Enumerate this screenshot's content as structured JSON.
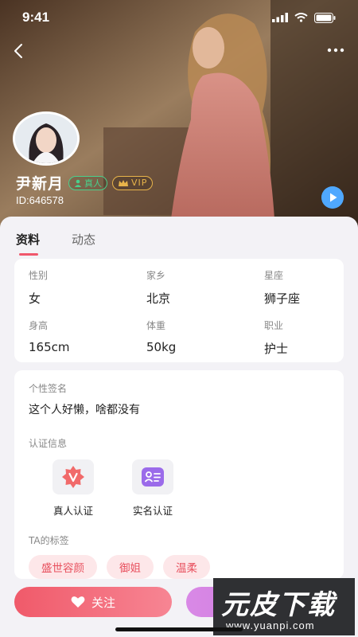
{
  "status_bar": {
    "time": "9:41"
  },
  "profile": {
    "name": "尹新月",
    "real_badge": "真人",
    "vip_badge": "VIP",
    "id_text": "ID:646578"
  },
  "tabs": [
    {
      "label": "资料"
    },
    {
      "label": "动态"
    }
  ],
  "info": [
    {
      "label": "性别",
      "value": "女"
    },
    {
      "label": "家乡",
      "value": "北京"
    },
    {
      "label": "星座",
      "value": "狮子座"
    },
    {
      "label": "身高",
      "value": "165cm"
    },
    {
      "label": "体重",
      "value": "50kg"
    },
    {
      "label": "职业",
      "value": "护士"
    }
  ],
  "signature": {
    "title": "个性签名",
    "text": "这个人好懒，啥都没有"
  },
  "verification": {
    "title": "认证信息",
    "items": [
      {
        "label": "真人认证"
      },
      {
        "label": "实名认证"
      }
    ]
  },
  "tags": {
    "title": "TA的标签",
    "items": [
      "盛世容颜",
      "御姐",
      "温柔"
    ]
  },
  "actions": {
    "follow_label": "关注"
  },
  "watermark": {
    "title": "元皮下载",
    "url": "www.yuanpi.com"
  },
  "colors": {
    "accent": "#f0576c",
    "tag_bg": "#fde7e9",
    "chat": "#c670d8",
    "play": "#4fa8ff"
  }
}
